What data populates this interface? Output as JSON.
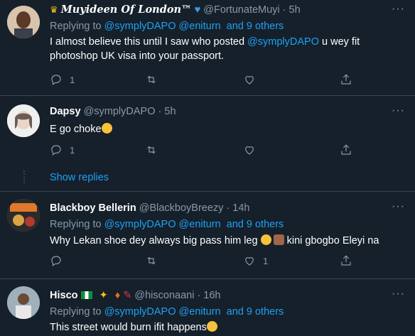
{
  "tweets": [
    {
      "name": "Muyideen Of London™",
      "handle": "@FortunateMuyi · 5h",
      "replying_prefix": "Replying to ",
      "reply_user1": "@symplyDAPO",
      "reply_user2": "@eniturn",
      "reply_others": "and 9 others",
      "text_part1": "I almost believe this until I saw who posted ",
      "text_mention": "@symplyDAPO",
      "text_part2": " u wey fit photoshop UK visa into your passport.",
      "reply_count": "1",
      "retweet_count": "",
      "like_count": ""
    },
    {
      "name": "Dapsy",
      "handle": "@symplyDAPO · 5h",
      "text": "E go choke",
      "reply_count": "1",
      "retweet_count": "",
      "like_count": ""
    },
    {
      "name": "Blackboy Bellerin",
      "handle": "@BlackboyBreezy · 14h",
      "replying_prefix": "Replying to ",
      "reply_user1": "@symplyDAPO",
      "reply_user2": "@eniturn",
      "reply_others": "and 9 others",
      "text_part1": "Why Lekan shoe dey always big pass him leg ",
      "text_part2": " kini gbogbo Eleyi na",
      "reply_count": "",
      "retweet_count": "",
      "like_count": "1"
    },
    {
      "name": "Hisco",
      "handle": "@hisconaani · 16h",
      "replying_prefix": "Replying to ",
      "reply_user1": "@symplyDAPO",
      "reply_user2": "@eniturn",
      "reply_others": "and 9 others",
      "text": "This street would burn ifit happens"
    }
  ],
  "show_replies": "Show replies",
  "more_glyph": "···",
  "colors": {
    "background": "#15202b",
    "accent": "#1da1f2",
    "muted": "#8899a6",
    "divider": "#38444d"
  }
}
